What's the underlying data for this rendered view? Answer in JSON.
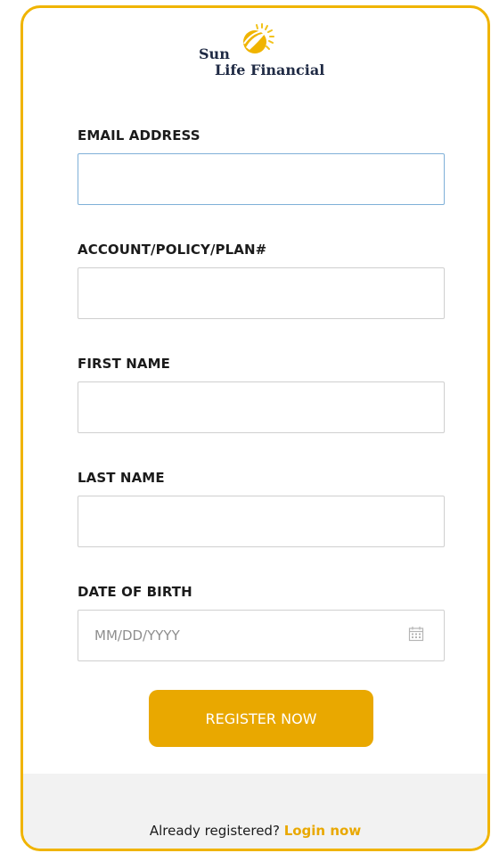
{
  "brand": {
    "name_line1": "Sun",
    "name_line2": "Life Financial",
    "accent_color": "#f0b400",
    "button_color": "#e9a800",
    "logo_icon": "sun-rays-icon"
  },
  "form": {
    "email": {
      "label": "EMAIL ADDRESS",
      "value": "",
      "placeholder": ""
    },
    "account": {
      "label": "ACCOUNT/POLICY/PLAN#",
      "value": "",
      "placeholder": ""
    },
    "first_name": {
      "label": "FIRST NAME",
      "value": "",
      "placeholder": ""
    },
    "last_name": {
      "label": "LAST NAME",
      "value": "",
      "placeholder": ""
    },
    "dob": {
      "label": "DATE OF BIRTH",
      "value": "",
      "placeholder": "MM/DD/YYYY",
      "icon": "calendar-icon"
    },
    "submit_label": "REGISTER NOW"
  },
  "footer": {
    "prompt": "Already registered? ",
    "link_label": "Login now"
  }
}
